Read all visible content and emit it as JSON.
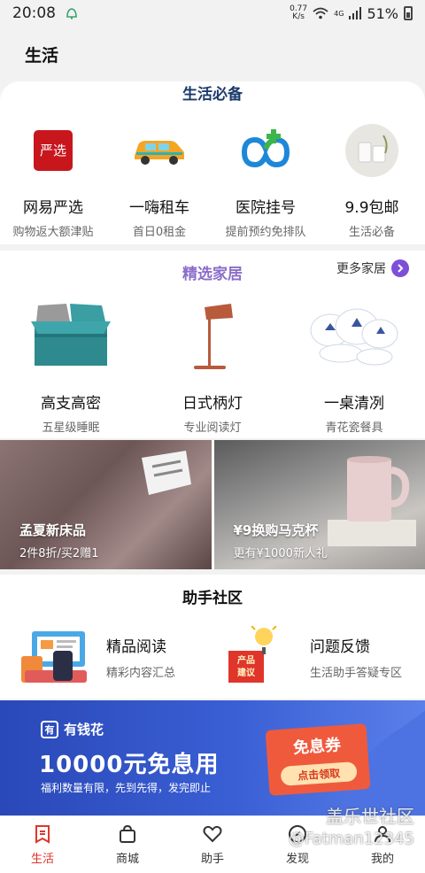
{
  "status_bar": {
    "time": "20:08",
    "net_speed_value": "0.77",
    "net_speed_unit": "K/s",
    "network_type": "4G",
    "battery": "51%"
  },
  "header": {
    "title": "生活"
  },
  "essentials": {
    "title": "生活必备",
    "items": [
      {
        "name": "网易严选",
        "sub": "购物返大额津贴",
        "icon": "yanxuan-app-icon"
      },
      {
        "name": "一嗨租车",
        "sub": "首日0租金",
        "icon": "car-rental-icon"
      },
      {
        "name": "医院挂号",
        "sub": "提前预约免排队",
        "icon": "hospital-icon"
      },
      {
        "name": "9.9包邮",
        "sub": "生活必备",
        "icon": "cups-icon"
      }
    ],
    "yanxuan_logo_text": "严选"
  },
  "home": {
    "title": "精选家居",
    "more_label": "更多家居",
    "items": [
      {
        "name": "高支高密",
        "sub": "五星级睡眠"
      },
      {
        "name": "日式柄灯",
        "sub": "专业阅读灯"
      },
      {
        "name": "一桌清冽",
        "sub": "青花瓷餐具"
      }
    ]
  },
  "promos": [
    {
      "title": "孟夏新床品",
      "sub": "2件8折/买2赠1"
    },
    {
      "title": "¥9换购马克杯",
      "sub": "更有¥1000新人礼"
    }
  ],
  "community": {
    "title": "助手社区",
    "items": [
      {
        "name": "精品阅读",
        "sub": "精彩内容汇总"
      },
      {
        "name": "问题反馈",
        "sub": "生活助手答疑专区",
        "icon_text": "产品\n建议"
      }
    ]
  },
  "ad": {
    "brand": "有钱花",
    "brand_logo": "有",
    "headline": "10000元免息用",
    "sub": "福利数量有限，先到先得，发完即止",
    "coupon_title": "免息券",
    "coupon_button": "点击领取"
  },
  "tabs": [
    {
      "label": "生活",
      "icon": "life-icon",
      "active": true
    },
    {
      "label": "商城",
      "icon": "shopping-bag-icon",
      "active": false
    },
    {
      "label": "助手",
      "icon": "heart-icon",
      "active": false
    },
    {
      "label": "发现",
      "icon": "compass-icon",
      "active": false
    },
    {
      "label": "我的",
      "icon": "user-icon",
      "active": false
    }
  ],
  "watermark": {
    "line1": "盖乐世社区",
    "line2": "@Fatman12345"
  },
  "colors": {
    "accent_red": "#e0352b",
    "home_title": "#8b6ec9",
    "essentials_title": "#1b3a6b",
    "ad_blue": "#2a48b8"
  }
}
